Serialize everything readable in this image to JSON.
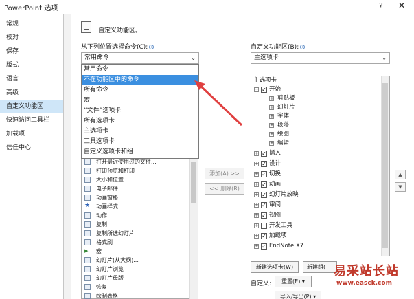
{
  "window": {
    "title": "PowerPoint 选项",
    "help": "?",
    "close": "✕"
  },
  "sidebar": {
    "items": [
      {
        "label": "常规"
      },
      {
        "label": "校对"
      },
      {
        "label": "保存"
      },
      {
        "label": "版式"
      },
      {
        "label": "语言"
      },
      {
        "label": "高级"
      },
      {
        "label": "自定义功能区",
        "active": true
      },
      {
        "label": "快速访问工具栏"
      },
      {
        "label": "加载项"
      },
      {
        "label": "信任中心"
      }
    ]
  },
  "header": {
    "icon": "ribbon-doc-icon",
    "title": "自定义功能区。"
  },
  "left": {
    "label": "从下列位置选择命令(C):",
    "select_value": "常用命令",
    "dropdown_options": [
      "常用命令",
      "不在功能区中的命令",
      "所有命令",
      "宏",
      "“文件”选项卡",
      "所有选项卡",
      "主选项卡",
      "工具选项卡",
      "自定义选项卡和组"
    ],
    "selected_option": "不在功能区中的命令",
    "commands": [
      "打开最近使用过的文件...",
      "打印预览和打印",
      "大小和位置...",
      "电子邮件",
      "动画窗格",
      "动画样式",
      "动作",
      "复制",
      "复制所选幻灯片",
      "格式刷",
      "宏",
      "幻灯片(从大纲)...",
      "幻灯片浏览",
      "幻灯片母版",
      "恢复",
      "绘制表格"
    ]
  },
  "middle": {
    "add_button": "添加(A) >>",
    "remove_button": "<< 删除(R)"
  },
  "right": {
    "label": "自定义功能区(B):",
    "select_value": "主选项卡",
    "tree": [
      {
        "level": 0,
        "text": "主选项卡"
      },
      {
        "level": 1,
        "text": "开始",
        "expand": "⊟",
        "checked": true
      },
      {
        "level": 2,
        "text": "剪贴板",
        "expand": "⊞"
      },
      {
        "level": 2,
        "text": "幻灯片",
        "expand": "⊞"
      },
      {
        "level": 2,
        "text": "字体",
        "expand": "⊞"
      },
      {
        "level": 2,
        "text": "段落",
        "expand": "⊞"
      },
      {
        "level": 2,
        "text": "绘图",
        "expand": "⊞"
      },
      {
        "level": 2,
        "text": "编辑",
        "expand": "⊞"
      },
      {
        "level": 1,
        "text": "插入",
        "expand": "⊞",
        "checked": true
      },
      {
        "level": 1,
        "text": "设计",
        "expand": "⊞",
        "checked": true
      },
      {
        "level": 1,
        "text": "切换",
        "expand": "⊞",
        "checked": true
      },
      {
        "level": 1,
        "text": "动画",
        "expand": "⊞",
        "checked": true
      },
      {
        "level": 1,
        "text": "幻灯片放映",
        "expand": "⊞",
        "checked": true
      },
      {
        "level": 1,
        "text": "审阅",
        "expand": "⊞",
        "checked": true
      },
      {
        "level": 1,
        "text": "视图",
        "expand": "⊞",
        "checked": true
      },
      {
        "level": 1,
        "text": "开发工具",
        "expand": "⊞",
        "checked": false
      },
      {
        "level": 1,
        "text": "加载项",
        "expand": "⊞",
        "checked": true
      },
      {
        "level": 1,
        "text": "EndNote X7",
        "expand": "⊞",
        "checked": true
      }
    ],
    "new_tab_button": "新建选项卡(W)",
    "new_group_button": "新建组(",
    "custom_label": "自定义:",
    "reset_button": "重置(E) ▾",
    "import_export_button": "导入/导出(P) ▾",
    "move_up": "▲",
    "move_down": "▼"
  },
  "watermark": {
    "big": "易采站长站",
    "small": "www.easck.com"
  },
  "colors": {
    "accent": "#3b8fe0",
    "active_nav": "#cfe6f8",
    "arrow": "#e04040",
    "watermark": "#c0392b"
  }
}
